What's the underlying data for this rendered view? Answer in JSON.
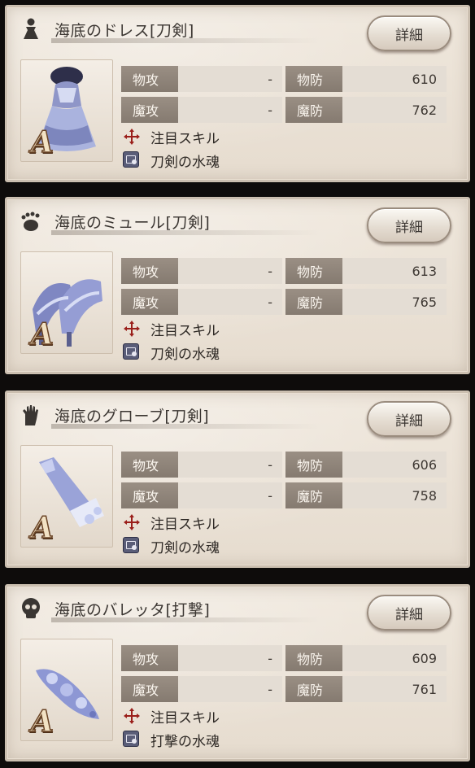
{
  "accent": {
    "label_bg": "#8f857b",
    "value_bg": "#e4ddd4",
    "rank_color": "#f2e2c4",
    "skill_icon": "#9a1e1a"
  },
  "items": [
    {
      "name": "海底のドレス[刀剣]",
      "slot_icon": "dress-icon",
      "detail_label": "詳細",
      "rank": "A",
      "patk_label": "物攻",
      "patk_value": "-",
      "pdef_label": "物防",
      "pdef_value": "610",
      "matk_label": "魔攻",
      "matk_value": "-",
      "mdef_label": "魔防",
      "mdef_value": "762",
      "skill_label": "注目スキル",
      "skill_name": "刀剣の水魂"
    },
    {
      "name": "海底のミュール[刀剣]",
      "slot_icon": "footprint-icon",
      "detail_label": "詳細",
      "rank": "A",
      "patk_label": "物攻",
      "patk_value": "-",
      "pdef_label": "物防",
      "pdef_value": "613",
      "matk_label": "魔攻",
      "matk_value": "-",
      "mdef_label": "魔防",
      "mdef_value": "765",
      "skill_label": "注目スキル",
      "skill_name": "刀剣の水魂"
    },
    {
      "name": "海底のグローブ[刀剣]",
      "slot_icon": "hand-icon",
      "detail_label": "詳細",
      "rank": "A",
      "patk_label": "物攻",
      "patk_value": "-",
      "pdef_label": "物防",
      "pdef_value": "606",
      "matk_label": "魔攻",
      "matk_value": "-",
      "mdef_label": "魔防",
      "mdef_value": "758",
      "skill_label": "注目スキル",
      "skill_name": "刀剣の水魂"
    },
    {
      "name": "海底のバレッタ[打撃]",
      "slot_icon": "skull-icon",
      "detail_label": "詳細",
      "rank": "A",
      "patk_label": "物攻",
      "patk_value": "-",
      "pdef_label": "物防",
      "pdef_value": "609",
      "matk_label": "魔攻",
      "matk_value": "-",
      "mdef_label": "魔防",
      "mdef_value": "761",
      "skill_label": "注目スキル",
      "skill_name": "打撃の水魂"
    }
  ]
}
